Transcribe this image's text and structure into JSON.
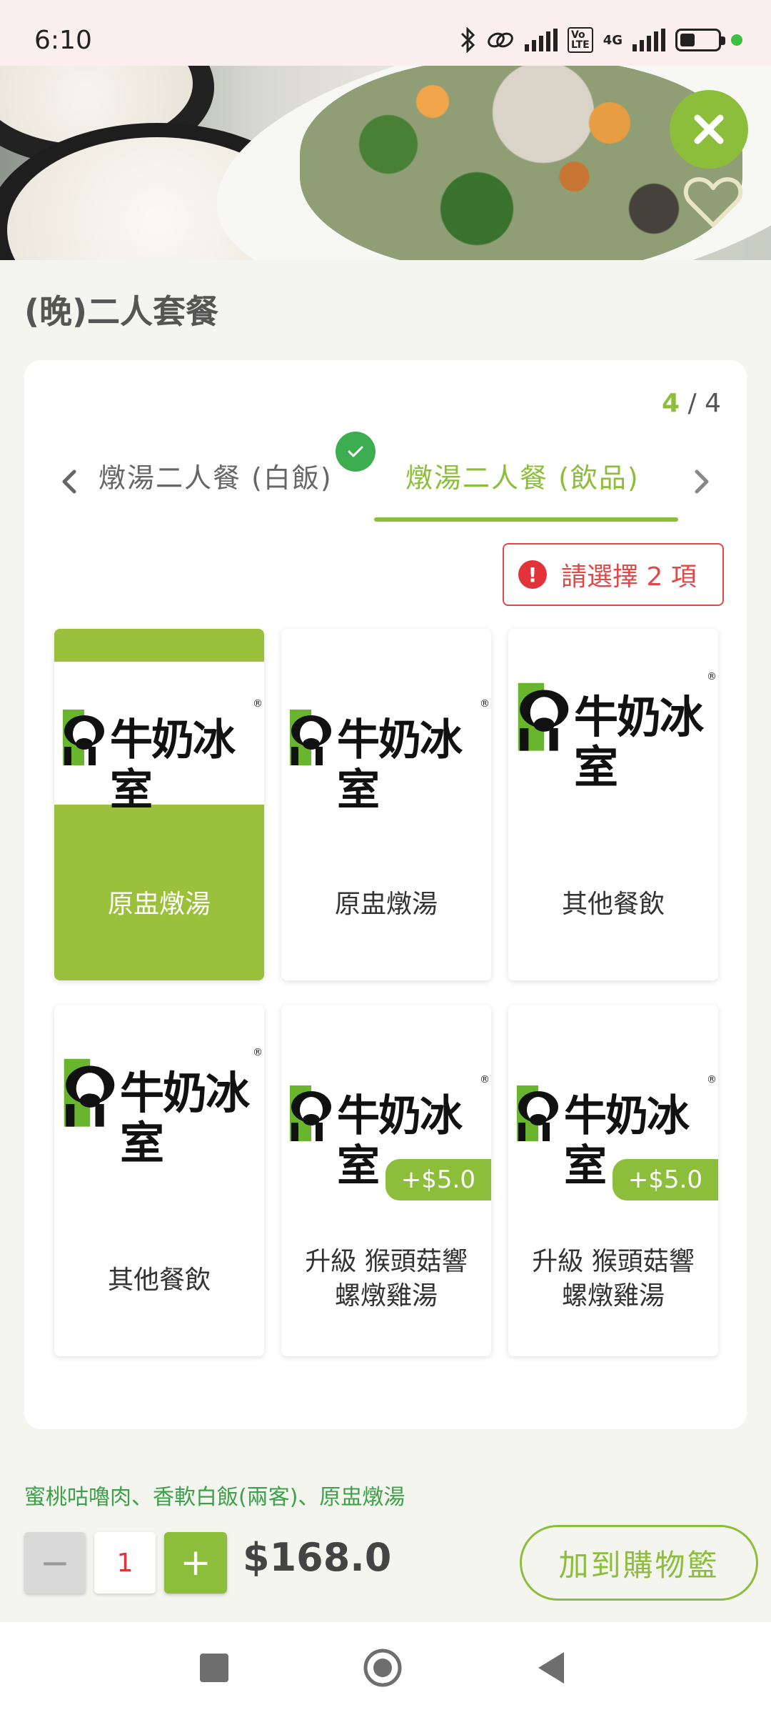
{
  "status_bar": {
    "time": "6:10",
    "network": "4G"
  },
  "hero": {
    "close_icon": "close-icon",
    "favorite_icon": "heart-icon"
  },
  "title": "(晚)二人套餐",
  "steps": {
    "current": "4",
    "separator": " / ",
    "total": "4"
  },
  "tabs": [
    {
      "label": "燉湯二人餐 (白飯)",
      "completed": true
    },
    {
      "label": "燉湯二人餐 (飲品)",
      "active": true
    }
  ],
  "requirement": {
    "text": "請選擇 2 項"
  },
  "brand_logo_text": "牛奶冰室",
  "items": [
    {
      "label": "原盅燉湯",
      "selected": true,
      "extra": ""
    },
    {
      "label": "原盅燉湯",
      "selected": false,
      "extra": ""
    },
    {
      "label": "其他餐飲",
      "selected": false,
      "extra": ""
    },
    {
      "label": "其他餐飲",
      "selected": false,
      "extra": ""
    },
    {
      "label_line1": "升級 猴頭菇響",
      "label_line2": "螺燉雞湯",
      "selected": false,
      "extra": "+$5.0"
    },
    {
      "label_line1": "升級 猴頭菇響",
      "label_line2": "螺燉雞湯",
      "selected": false,
      "extra": "+$5.0"
    }
  ],
  "summary": "蜜桃咕嚕肉、香軟白飯(兩客)、原盅燉湯",
  "quantity": {
    "minus": "−",
    "value": "1",
    "plus": "+"
  },
  "price": "$168.0",
  "add_to_cart": "加到購物籃",
  "colors": {
    "accent": "#8cbe3c",
    "error": "#e0484a",
    "success": "#3cae4f"
  }
}
